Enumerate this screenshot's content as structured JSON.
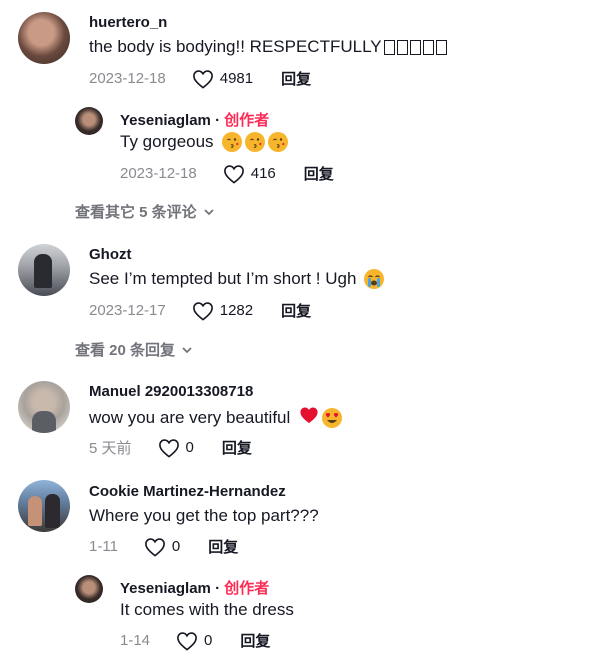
{
  "comments": [
    {
      "username": "huertero_n",
      "text": "the body is bodying!! RESPECTFULLY ",
      "trailing_unrendered_glyph_count": 5,
      "date": "2023-12-18",
      "likes": "4981",
      "reply_label": "回复",
      "avatar_color": "#6a4a3e"
    },
    {
      "username": "Yeseniaglam",
      "creator_separator": "·",
      "creator_badge": "创作者",
      "text": "Ty gorgeous",
      "emojis": [
        "kissing-face-emoji",
        "kissing-face-emoji",
        "kissing-face-emoji"
      ],
      "date": "2023-12-18",
      "likes": "416",
      "reply_label": "回复",
      "avatar_color": "#3a2e2b"
    },
    {
      "username": "Ghozt",
      "text": "See I’m tempted but I’m short ! Ugh",
      "emojis": [
        "crying-face-emoji"
      ],
      "date": "2023-12-17",
      "likes": "1282",
      "reply_label": "回复",
      "avatar_color": "#7a7d86"
    },
    {
      "username": "Manuel 2920013308718",
      "text": "wow you are very beautiful",
      "emojis": [
        "red-heart-emoji",
        "heart-eyes-emoji"
      ],
      "date": "5 天前",
      "likes": "0",
      "reply_label": "回复",
      "avatar_color": "#a8a29b"
    },
    {
      "username": "Cookie Martinez-Hernandez",
      "text": "Where you get the top part???",
      "date": "1-11",
      "likes": "0",
      "reply_label": "回复",
      "avatar_color": "#5f7a9a"
    },
    {
      "username": "Yeseniaglam",
      "creator_separator": "·",
      "creator_badge": "创作者",
      "text": "It comes with the dress",
      "date": "1-14",
      "likes": "0",
      "reply_label": "回复",
      "avatar_color": "#3a2e2b"
    }
  ],
  "view_more": [
    {
      "label": "查看其它 5 条评论"
    },
    {
      "label": "查看 20 条回复"
    }
  ],
  "colors": {
    "creator_badge": "#fe2c55",
    "meta_gray": "#8a8b91",
    "text_dark": "#161823",
    "emoji_yellow": "#f7b52c",
    "heart_red": "#e3102f"
  }
}
